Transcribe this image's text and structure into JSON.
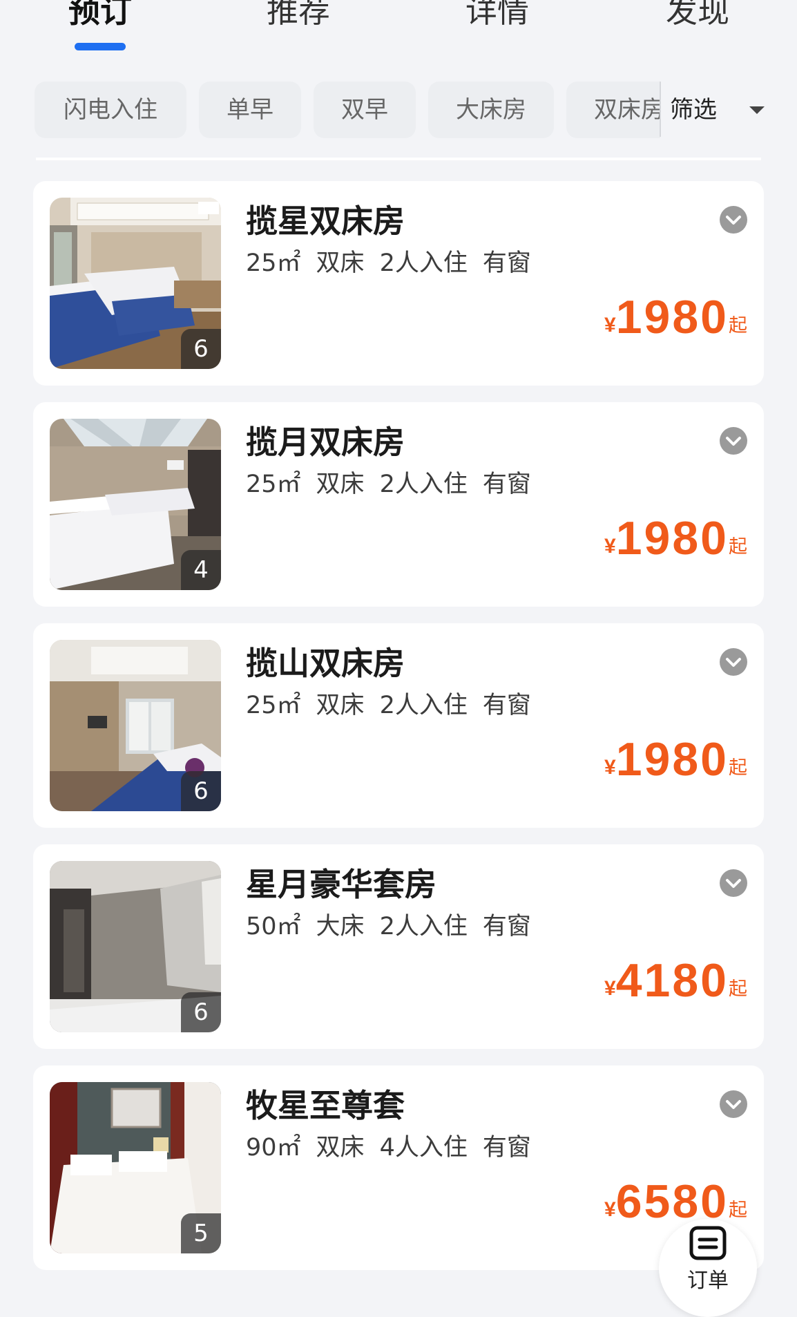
{
  "tabs": [
    {
      "label": "预订",
      "active": true
    },
    {
      "label": "推荐",
      "active": false
    },
    {
      "label": "详情",
      "active": false
    },
    {
      "label": "发现",
      "active": false
    }
  ],
  "filters": {
    "chips": [
      "闪电入住",
      "单早",
      "双早",
      "大床房",
      "双床房"
    ],
    "filter_label": "筛选"
  },
  "rooms": [
    {
      "name": "揽星双床房",
      "area": "25㎡",
      "bed": "双床",
      "occupancy": "2人入住",
      "window": "有窗",
      "currency": "¥",
      "price": "1980",
      "price_suffix": "起",
      "photo_count": "6"
    },
    {
      "name": "揽月双床房",
      "area": "25㎡",
      "bed": "双床",
      "occupancy": "2人入住",
      "window": "有窗",
      "currency": "¥",
      "price": "1980",
      "price_suffix": "起",
      "photo_count": "4"
    },
    {
      "name": "揽山双床房",
      "area": "25㎡",
      "bed": "双床",
      "occupancy": "2人入住",
      "window": "有窗",
      "currency": "¥",
      "price": "1980",
      "price_suffix": "起",
      "photo_count": "6"
    },
    {
      "name": "星月豪华套房",
      "area": "50㎡",
      "bed": "大床",
      "occupancy": "2人入住",
      "window": "有窗",
      "currency": "¥",
      "price": "4180",
      "price_suffix": "起",
      "photo_count": "6"
    },
    {
      "name": "牧星至尊套",
      "area": "90㎡",
      "bed": "双床",
      "occupancy": "4人入住",
      "window": "有窗",
      "currency": "¥",
      "price": "6580",
      "price_suffix": "起",
      "photo_count": "5"
    }
  ],
  "order_button": {
    "label": "订单",
    "icon": "order-list-icon"
  },
  "colors": {
    "accent": "#1e6ff1",
    "price": "#f05a1a",
    "background": "#f3f4f7",
    "card": "#ffffff"
  }
}
